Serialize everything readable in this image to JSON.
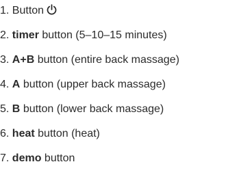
{
  "items": [
    {
      "num": "1.",
      "plain_after": "Button",
      "icon": "power-icon"
    },
    {
      "num": "2.",
      "bold": "timer",
      "rest": "button (5–10–15 minutes)"
    },
    {
      "num": "3.",
      "bold": "A+B",
      "rest": "button (entire back massage)"
    },
    {
      "num": "4.",
      "bold": "A",
      "rest": "button (upper back massage)"
    },
    {
      "num": "5.",
      "bold": "B",
      "rest": "button (lower back massage)"
    },
    {
      "num": "6.",
      "bold": "heat",
      "rest": "button (heat)"
    },
    {
      "num": "7.",
      "bold": "demo",
      "rest": "button"
    }
  ],
  "colors": {
    "text": "#2b2b2b",
    "background": "#ffffff"
  }
}
